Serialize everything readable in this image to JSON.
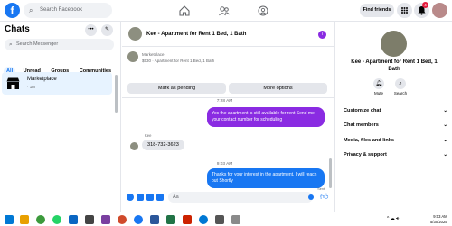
{
  "topbar": {
    "logo": "f",
    "search_placeholder": "Search Facebook",
    "find_friends": "Find friends",
    "notification_count": "4",
    "nav_icons": [
      "home-icon",
      "friends-icon",
      "groups-icon"
    ]
  },
  "left": {
    "title": "Chats",
    "search_placeholder": "Search Messenger",
    "filters": [
      "All",
      "Unread",
      "Groups",
      "Communities"
    ],
    "active_filter": "All",
    "conversation": {
      "name": "Marketplace",
      "time": "· 1m"
    }
  },
  "chat": {
    "header_title": "Kee - Apartment for Rent 1 Bed, 1 Bath",
    "marketplace_line1": "Marketplace",
    "marketplace_line2": "$530 · Apartment for Rent 1 Bed, 1 Bath",
    "btn_pending": "Mark as pending",
    "btn_more": "More options",
    "time1": "7:28 AM",
    "msg_out1": "Yes the apartment is still available for rent Send me your contact number for scheduling",
    "sender": "Kee",
    "msg_in": "318-732-3623",
    "time2": "9:03 AM",
    "msg_out2": "Thanks for your interest in the apartment. I will reach out Shortly",
    "sent": "Sent",
    "composer_placeholder": "Aa"
  },
  "right": {
    "title": "Kee - Apartment for Rent 1 Bed, 1 Bath",
    "mute": "Mute",
    "search": "Search",
    "items": [
      "Customize chat",
      "Chat members",
      "Media, files and links",
      "Privacy & support"
    ]
  },
  "taskbar": {
    "time": "9:03 AM",
    "date": "5/30/2025"
  },
  "colors": {
    "accent": "#1877f2",
    "purple": "#8a2be2",
    "bg_gray": "#f0f2f5"
  }
}
